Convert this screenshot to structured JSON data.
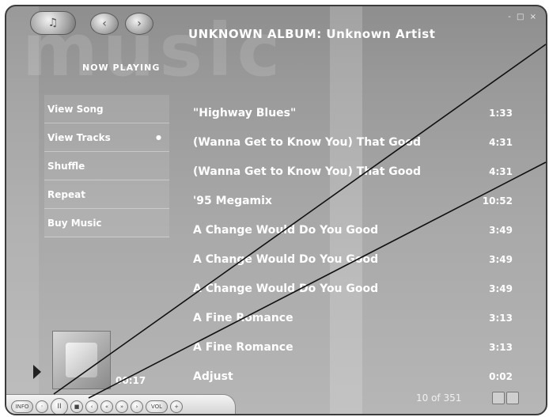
{
  "window": {
    "watermark": "music",
    "controls": "- □ ×"
  },
  "titlebar": {
    "music_icon": "music-note-icon",
    "back_icon": "back-icon",
    "forward_icon": "forward-icon"
  },
  "header": {
    "title": "UNKNOWN ALBUM: Unknown Artist",
    "section": "NOW PLAYING"
  },
  "side_menu": [
    {
      "label": "View Song"
    },
    {
      "label": "View Tracks",
      "selected": true
    },
    {
      "label": "Shuffle"
    },
    {
      "label": "Repeat"
    },
    {
      "label": "Buy Music"
    }
  ],
  "tracks": [
    {
      "name": "\"Highway Blues\"",
      "duration": "1:33"
    },
    {
      "name": "(Wanna Get to Know You) That Good",
      "duration": "4:31"
    },
    {
      "name": "(Wanna Get to Know You) That Good",
      "duration": "4:31"
    },
    {
      "name": "'95 Megamix",
      "duration": "10:52"
    },
    {
      "name": "A Change Would Do You Good",
      "duration": "3:49"
    },
    {
      "name": "A Change Would Do You Good",
      "duration": "3:49"
    },
    {
      "name": "A Change Would Do You Good",
      "duration": "3:49"
    },
    {
      "name": "A Fine Romance",
      "duration": "3:13"
    },
    {
      "name": "A Fine Romance",
      "duration": "3:13"
    },
    {
      "name": "Adjust",
      "duration": "0:02"
    }
  ],
  "now_playing": {
    "elapsed": "00:17"
  },
  "pager": {
    "text": "10 of 351"
  },
  "transport": {
    "buttons": [
      {
        "name": "info-button",
        "label": "INFO"
      },
      {
        "name": "shuffle-button",
        "label": "◦"
      },
      {
        "name": "pause-button",
        "label": "II"
      },
      {
        "name": "stop-button",
        "label": "■"
      },
      {
        "name": "previous-button",
        "label": "‹"
      },
      {
        "name": "rewind-button",
        "label": "«"
      },
      {
        "name": "fast-forward-button",
        "label": "»"
      },
      {
        "name": "next-button",
        "label": "›"
      },
      {
        "name": "volume-button",
        "label": "VOL"
      },
      {
        "name": "volume-up-button",
        "label": "+"
      }
    ]
  }
}
